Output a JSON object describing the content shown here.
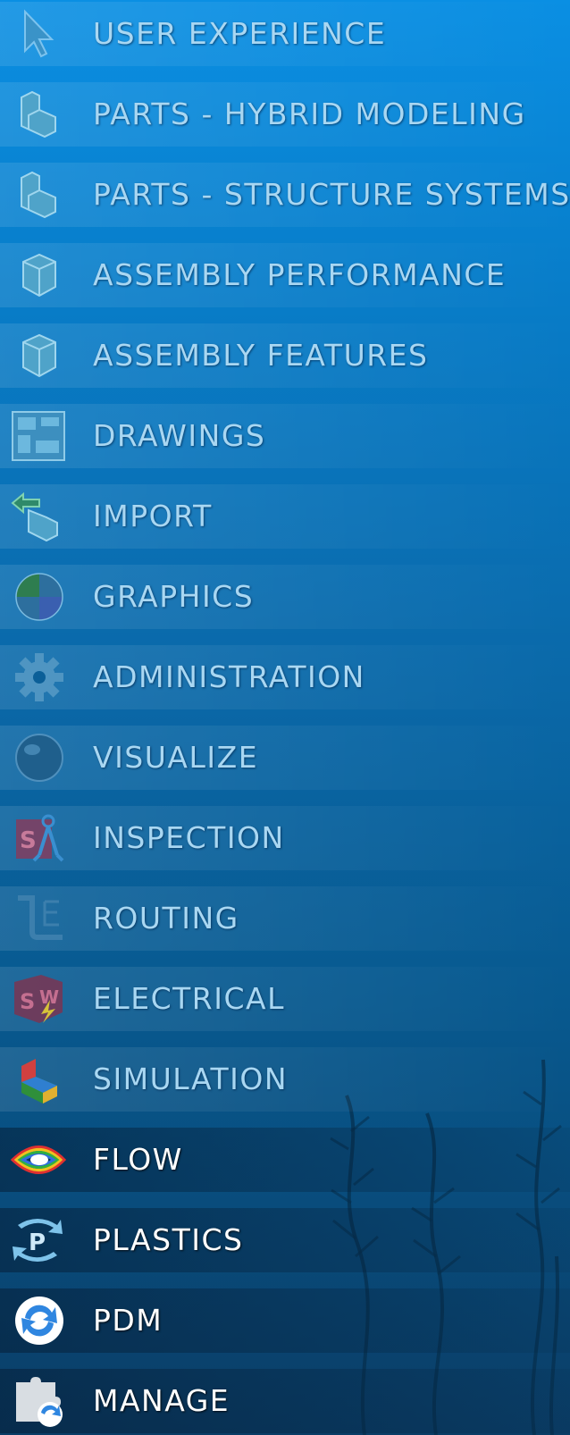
{
  "menu": {
    "items": [
      {
        "label": "USER EXPERIENCE",
        "icon": "cursor-arrow-icon"
      },
      {
        "label": "PARTS - HYBRID MODELING",
        "icon": "part-block-icon"
      },
      {
        "label": "PARTS - STRUCTURE SYSTEMS",
        "icon": "part-block-icon"
      },
      {
        "label": "ASSEMBLY PERFORMANCE",
        "icon": "assembly-cube-icon"
      },
      {
        "label": "ASSEMBLY FEATURES",
        "icon": "assembly-cube-icon"
      },
      {
        "label": "DRAWINGS",
        "icon": "drawing-sheet-icon"
      },
      {
        "label": "IMPORT",
        "icon": "import-arrow-icon"
      },
      {
        "label": "GRAPHICS",
        "icon": "graphics-sphere-icon"
      },
      {
        "label": "ADMINISTRATION",
        "icon": "gear-icon"
      },
      {
        "label": "VISUALIZE",
        "icon": "visualize-sphere-icon"
      },
      {
        "label": "INSPECTION",
        "icon": "inspection-caliper-icon"
      },
      {
        "label": "ROUTING",
        "icon": "routing-pipe-icon"
      },
      {
        "label": "ELECTRICAL",
        "icon": "electrical-bolt-icon"
      },
      {
        "label": "SIMULATION",
        "icon": "simulation-part-icon"
      },
      {
        "label": "FLOW",
        "icon": "flow-eye-icon"
      },
      {
        "label": "PLASTICS",
        "icon": "plastics-arrows-icon"
      },
      {
        "label": "PDM",
        "icon": "pdm-sync-icon"
      },
      {
        "label": "MANAGE",
        "icon": "manage-puzzle-icon"
      }
    ]
  },
  "colors": {
    "label_dim": "#a9d7f2",
    "label_bright": "#ffffff",
    "background_top": "#0a8fe3",
    "background_bottom": "#0a3d66"
  }
}
